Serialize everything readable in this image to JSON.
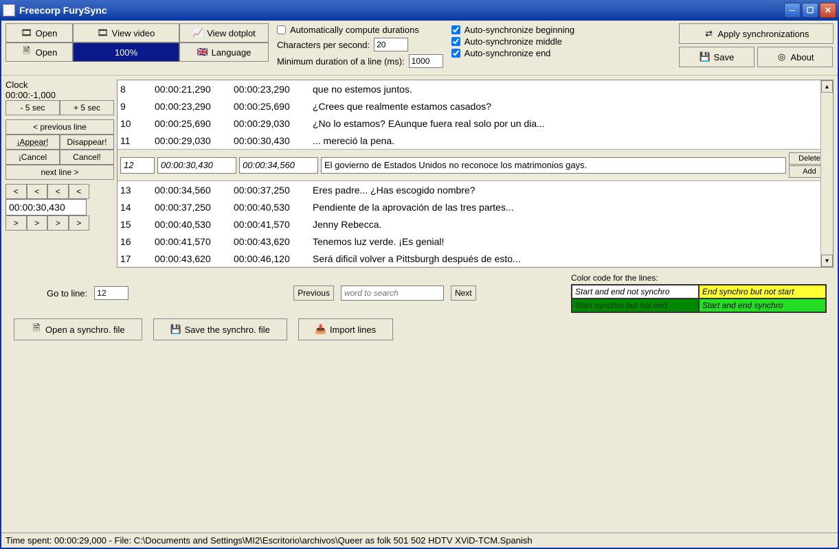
{
  "window": {
    "title": "Freecorp FurySync"
  },
  "toolbar": {
    "open1": "Open",
    "view_video": "View video",
    "view_dotplot": "View dotplot",
    "open2": "Open",
    "progress": "100%",
    "language": "Language"
  },
  "settings": {
    "auto_compute_label": "Automatically compute durations",
    "auto_compute_checked": false,
    "cps_label": "Characters per second:",
    "cps_value": "20",
    "min_dur_label": "Minimum duration of a line (ms):",
    "min_dur_value": "1000"
  },
  "autosync": {
    "begin_label": "Auto-synchronize beginning",
    "begin_checked": true,
    "middle_label": "Auto-synchronize middle",
    "middle_checked": true,
    "end_label": "Auto-synchronize end",
    "end_checked": true
  },
  "right_buttons": {
    "apply": "Apply synchronizations",
    "save": "Save",
    "about": "About"
  },
  "clock": {
    "label": "Clock",
    "value": "00:00:-1,000",
    "minus5": "- 5 sec",
    "plus5": "+ 5 sec"
  },
  "nav": {
    "prev_line": "< previous line",
    "appear": "¡Appear!",
    "disappear": "Disappear!",
    "cancel1": "¡Cancel",
    "cancel2": "Cancel!",
    "next_line": "next line >",
    "back_chars": [
      "<",
      "<",
      "<",
      "<"
    ],
    "current_time": "00:00:30,430",
    "fwd_chars": [
      ">",
      ">",
      ">",
      ">"
    ]
  },
  "lines_top": [
    {
      "n": "8",
      "start": "00:00:21,290",
      "end": "00:00:23,290",
      "text": "que no estemos juntos."
    },
    {
      "n": "9",
      "start": "00:00:23,290",
      "end": "00:00:25,690",
      "text": "¿Crees que realmente estamos casados?"
    },
    {
      "n": "10",
      "start": "00:00:25,690",
      "end": "00:00:29,030",
      "text": "¿No lo estamos? EAunque fuera real solo por un dia..."
    },
    {
      "n": "11",
      "start": "00:00:29,030",
      "end": "00:00:30,430",
      "text": "... mereció la pena."
    }
  ],
  "editor": {
    "n": "12",
    "start": "00:00:30,430",
    "end": "00:00:34,560",
    "text": "El govierno de Estados Unidos no reconoce los matrimonios gays.",
    "delete": "Delete",
    "add": "Add"
  },
  "lines_bottom": [
    {
      "n": "13",
      "start": "00:00:34,560",
      "end": "00:00:37,250",
      "text": "Eres padre... ¿Has escogido nombre?"
    },
    {
      "n": "14",
      "start": "00:00:37,250",
      "end": "00:00:40,530",
      "text": "Pendiente de la aprovación de las tres partes..."
    },
    {
      "n": "15",
      "start": "00:00:40,530",
      "end": "00:00:41,570",
      "text": "Jenny Rebecca."
    },
    {
      "n": "16",
      "start": "00:00:41,570",
      "end": "00:00:43,620",
      "text": "Tenemos luz verde. ¡Es genial!"
    },
    {
      "n": "17",
      "start": "00:00:43,620",
      "end": "00:00:46,120",
      "text": "Será dificil volver a Pittsburgh después de esto..."
    }
  ],
  "goto": {
    "label": "Go to line:",
    "value": "12"
  },
  "search": {
    "prev": "Previous",
    "placeholder": "word to search",
    "next": "Next"
  },
  "legend": {
    "title": "Color code for the lines:",
    "c1": "Start and end not synchro",
    "c2": "End synchro but not start",
    "c3": "Start synchro but not end",
    "c4": "Start and end synchro"
  },
  "filebuttons": {
    "open_sync": "Open a synchro. file",
    "save_sync": "Save the synchro. file",
    "import": "Import lines"
  },
  "status": "Time spent: 00:00:29,000 - File: C:\\Documents and Settings\\MI2\\Escritorio\\archivos\\Queer as folk 501 502 HDTV XViD-TCM.Spanish"
}
